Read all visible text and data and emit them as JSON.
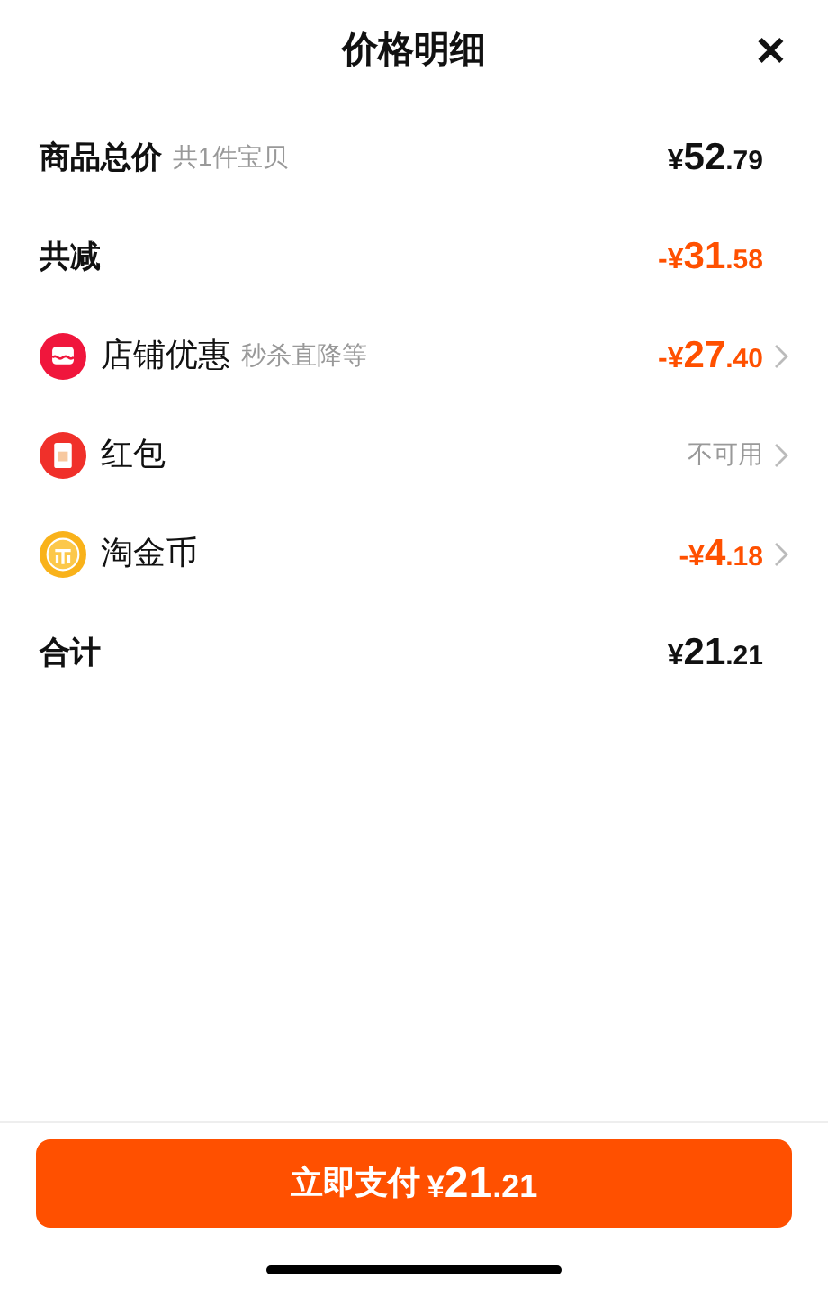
{
  "header": {
    "title": "价格明细",
    "close": "✕"
  },
  "rows": [
    {
      "kind": "summary",
      "label": "商品总价",
      "note": "共1件宝贝",
      "color": "#111111",
      "price": {
        "sign": "¥",
        "whole": "52",
        "fraction": ".79"
      }
    },
    {
      "kind": "summary",
      "label": "共减",
      "color": "#ff5000",
      "price": {
        "sign": "-¥",
        "whole": "31",
        "fraction": ".58"
      }
    },
    {
      "kind": "shop",
      "label": "店铺优惠",
      "note": "秒杀直降等",
      "color": "#ff5000",
      "price": {
        "sign": "-¥",
        "whole": "27",
        "fraction": ".40"
      }
    },
    {
      "kind": "red_packet",
      "label": "红包",
      "color": "#999999",
      "value": "不可用"
    },
    {
      "kind": "coin",
      "label": "淘金币",
      "color": "#ff5000",
      "price": {
        "sign": "-¥",
        "whole": "4",
        "fraction": ".18"
      }
    },
    {
      "kind": "summary",
      "label": "合计",
      "color": "#111111",
      "price": {
        "sign": "¥",
        "whole": "21",
        "fraction": ".21"
      }
    }
  ],
  "pay_button": {
    "label": "立即支付",
    "price": {
      "sign": "¥",
      "whole": "21",
      "fraction": ".21"
    }
  }
}
